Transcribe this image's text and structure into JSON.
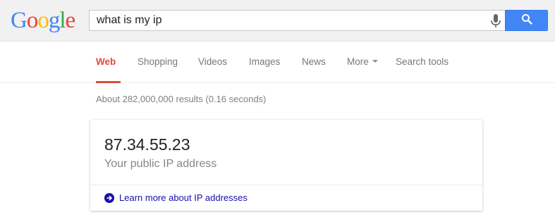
{
  "logo": {
    "letters": [
      "G",
      "o",
      "o",
      "g",
      "l",
      "e"
    ],
    "colors": [
      "#4285f4",
      "#ea4335",
      "#fbbc05",
      "#4285f4",
      "#34a853",
      "#ea4335"
    ]
  },
  "search": {
    "query": "what is my ip",
    "mic_icon": "microphone-icon",
    "button_icon": "search-icon"
  },
  "tabs": [
    {
      "label": "Web",
      "active": true
    },
    {
      "label": "Shopping"
    },
    {
      "label": "Videos"
    },
    {
      "label": "Images"
    },
    {
      "label": "News"
    },
    {
      "label": "More",
      "has_dropdown": true
    },
    {
      "label": "Search tools"
    }
  ],
  "stats": "About 282,000,000 results (0.16 seconds)",
  "answer_card": {
    "ip": "87.34.55.23",
    "subtitle": "Your public IP address",
    "link_icon": "arrow-right-circle-icon",
    "link_text": "Learn more about IP addresses"
  },
  "colors": {
    "accent_red": "#dd4b39",
    "search_button": "#4285f4",
    "link_blue": "#1a0dab"
  }
}
